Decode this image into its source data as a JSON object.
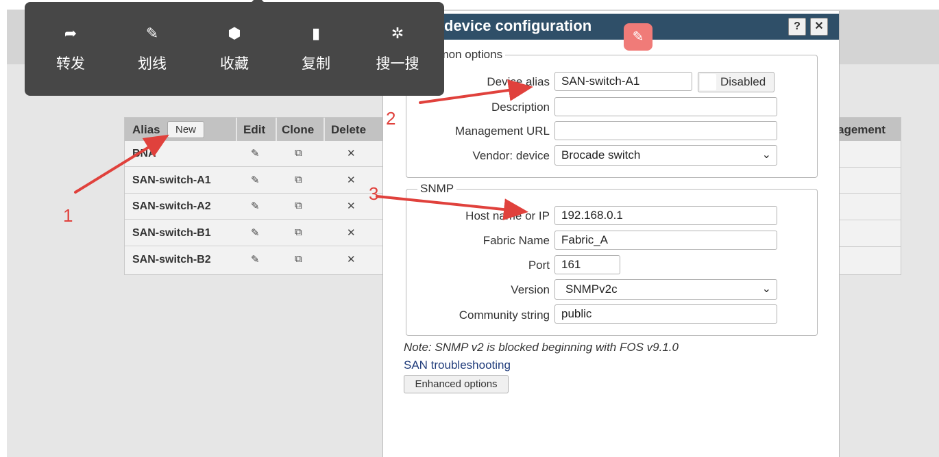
{
  "context_menu": {
    "items": [
      {
        "label": "转发",
        "icon": "share-icon"
      },
      {
        "label": "划线",
        "icon": "underline-icon"
      },
      {
        "label": "收藏",
        "icon": "cube-icon"
      },
      {
        "label": "复制",
        "icon": "copy-icon"
      },
      {
        "label": "搜一搜",
        "icon": "sparkle-search-icon"
      }
    ]
  },
  "table": {
    "headers": {
      "alias": "Alias",
      "new": "New",
      "edit": "Edit",
      "clone": "Clone",
      "delete": "Delete"
    },
    "rows": [
      {
        "alias": "BNA"
      },
      {
        "alias": "SAN-switch-A1"
      },
      {
        "alias": "SAN-switch-A2"
      },
      {
        "alias": "SAN-switch-B1"
      },
      {
        "alias": "SAN-switch-B2"
      }
    ],
    "right_header": "agement"
  },
  "dialog": {
    "title": "device configuration",
    "help": "?",
    "close": "✕",
    "common": {
      "legend": "nmon options",
      "device_alias_label": "Device alias",
      "device_alias_value": "SAN-switch-A1",
      "disabled_label": "Disabled",
      "description_label": "Description",
      "description_value": "",
      "management_url_label": "Management URL",
      "management_url_value": "",
      "vendor_label": "Vendor: device",
      "vendor_value": "Brocade switch"
    },
    "snmp": {
      "legend": "SNMP",
      "host_label": "Host name or IP",
      "host_value": "192.168.0.1",
      "fabric_label": "Fabric Name",
      "fabric_value": "Fabric_A",
      "port_label": "Port",
      "port_value": "161",
      "version_label": "Version",
      "version_value": "SNMPv2c",
      "community_label": "Community string",
      "community_value": "public"
    },
    "note": "Note: SNMP v2 is blocked beginning with FOS v9.1.0",
    "link": "SAN troubleshooting",
    "enhanced_button": "Enhanced options"
  },
  "annotations": [
    "1",
    "2",
    "3"
  ],
  "colors": {
    "title_bar": "#2f4f68",
    "annotation": "#e0413c",
    "toolbar": "#474747"
  }
}
